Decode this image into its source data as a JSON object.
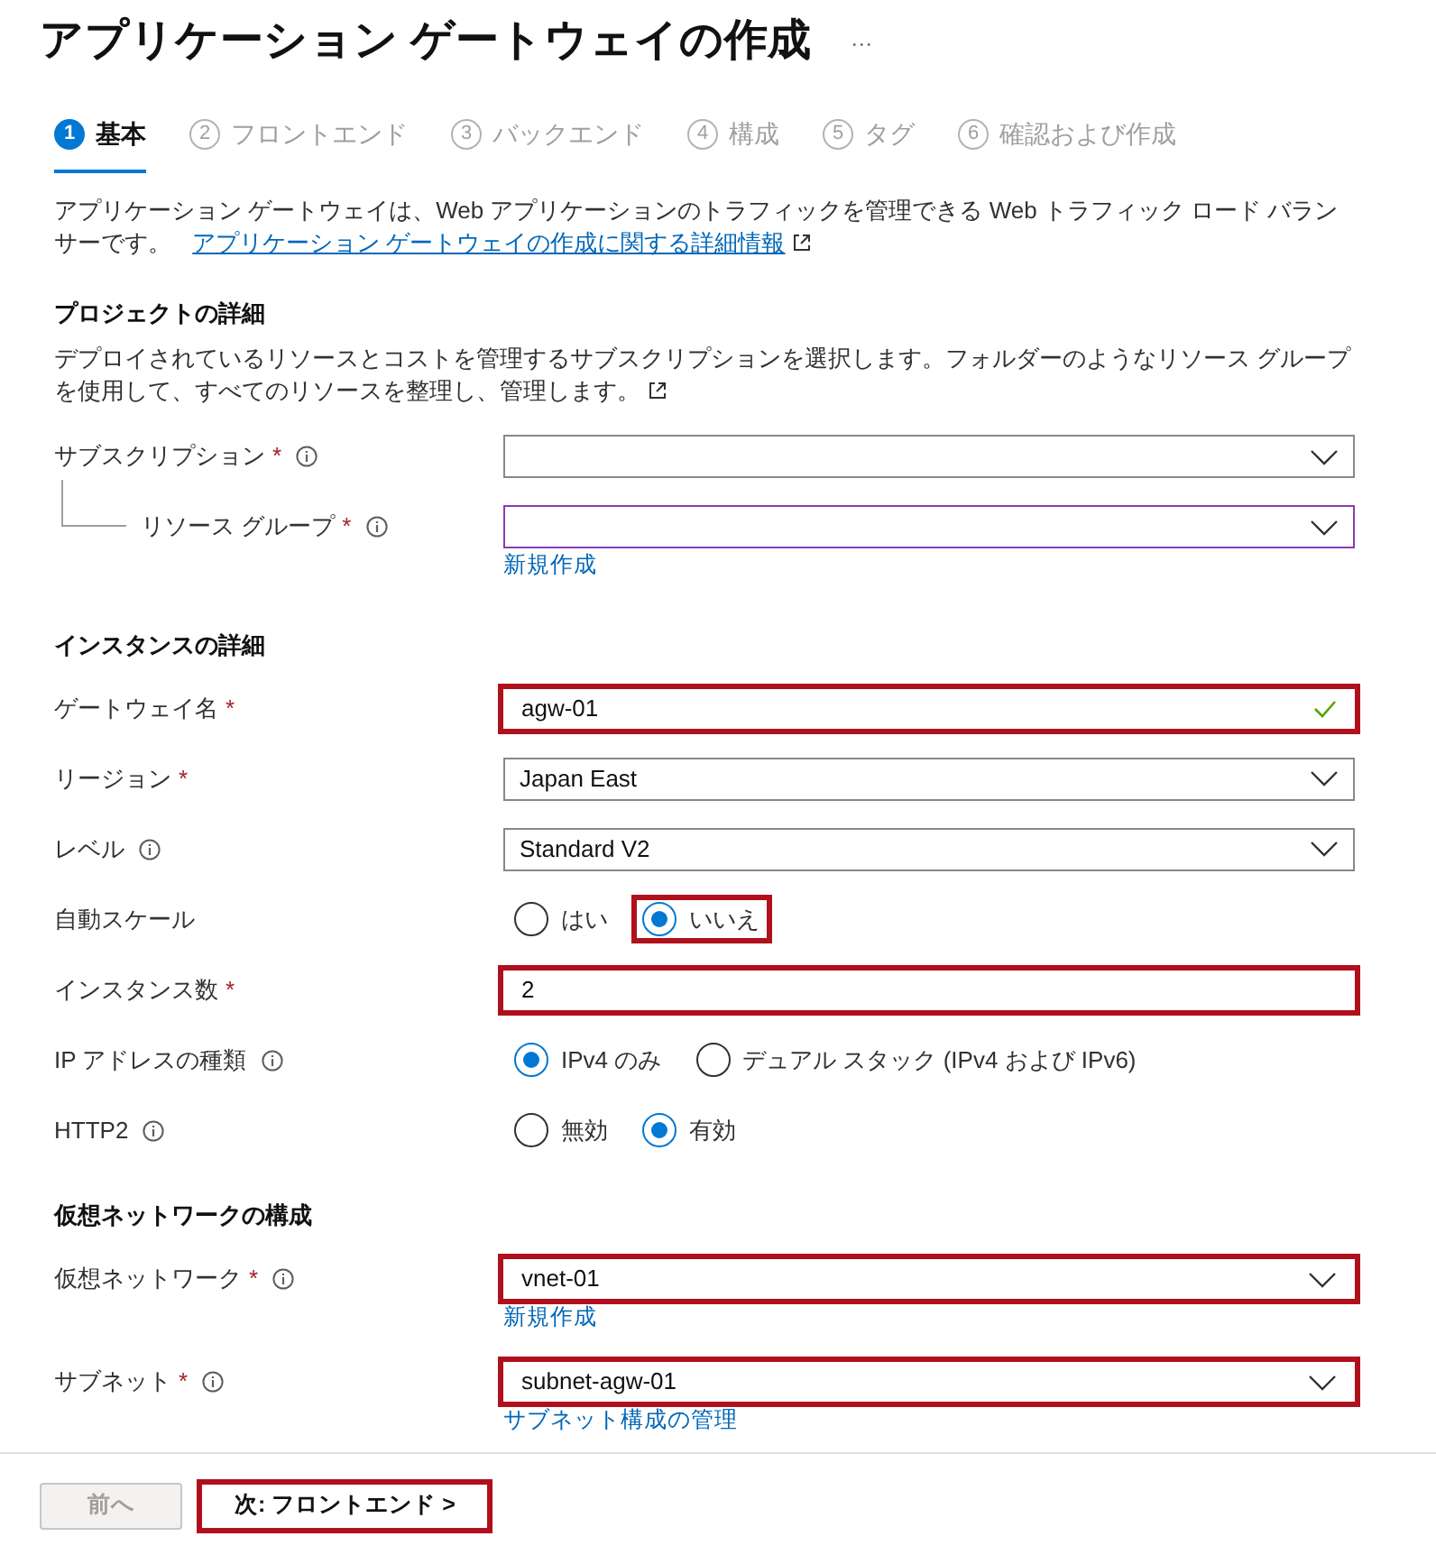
{
  "title": "アプリケーション ゲートウェイの作成",
  "more": "···",
  "steps": [
    {
      "number": "1",
      "label": "基本",
      "selected": true
    },
    {
      "number": "2",
      "label": "フロントエンド",
      "selected": false
    },
    {
      "number": "3",
      "label": "バックエンド",
      "selected": false
    },
    {
      "number": "4",
      "label": "構成",
      "selected": false
    },
    {
      "number": "5",
      "label": "タグ",
      "selected": false
    },
    {
      "number": "6",
      "label": "確認および作成",
      "selected": false
    }
  ],
  "intro": {
    "text": "アプリケーション ゲートウェイは、Web アプリケーションのトラフィックを管理できる Web トラフィック ロード バランサーです。",
    "link": "アプリケーション ゲートウェイの作成に関する詳細情報"
  },
  "sections": [
    {
      "heading": "プロジェクトの詳細",
      "description": "デプロイされているリソースとコストを管理するサブスクリプションを選択します。フォルダーのようなリソース グループを使用して、すべてのリソースを整理し、管理します。",
      "rows": [
        {
          "kind": "select",
          "label": "サブスクリプション",
          "required": "*",
          "info": true,
          "focused": false,
          "highlighted": false,
          "children": [
            {
              "kind": "select",
              "label": "リソース グループ",
              "required": "*",
              "info": true,
              "focused": true,
              "highlighted": false,
              "link": "新規作成"
            }
          ]
        }
      ]
    },
    {
      "heading": "インスタンスの詳細",
      "rows": [
        {
          "kind": "text",
          "label": "ゲートウェイ名",
          "required": "*",
          "value": "agw-01",
          "valid": true,
          "highlighted": true
        },
        {
          "kind": "select",
          "label": "リージョン",
          "required": "*",
          "value": "Japan East",
          "focused": false,
          "highlighted": false
        },
        {
          "kind": "select",
          "label": "レベル",
          "info": true,
          "value": "Standard V2",
          "focused": false,
          "highlighted": false
        },
        {
          "kind": "radio",
          "label": "自動スケール",
          "options": [
            {
              "label": "はい",
              "selected": false,
              "highlighted": false
            },
            {
              "label": "いいえ",
              "selected": true,
              "highlighted": true
            }
          ]
        },
        {
          "kind": "text",
          "label": "インスタンス数",
          "required": "*",
          "value": "2",
          "highlighted": true
        },
        {
          "kind": "radio",
          "label": "IP アドレスの種類",
          "info": true,
          "options": [
            {
              "label": "IPv4 のみ",
              "selected": true,
              "highlighted": false
            },
            {
              "label": "デュアル スタック (IPv4 および IPv6)",
              "selected": false,
              "highlighted": false
            }
          ]
        },
        {
          "kind": "radio",
          "label": "HTTP2",
          "info": true,
          "options": [
            {
              "label": "無効",
              "selected": false,
              "highlighted": false
            },
            {
              "label": "有効",
              "selected": true,
              "highlighted": false
            }
          ]
        }
      ]
    },
    {
      "heading": "仮想ネットワークの構成",
      "rows": [
        {
          "kind": "select",
          "label": "仮想ネットワーク",
          "required": "*",
          "info": true,
          "value": "vnet-01",
          "highlighted": true,
          "link": "新規作成"
        },
        {
          "kind": "select",
          "label": "サブネット",
          "required": "*",
          "info": true,
          "value": "subnet-agw-01",
          "highlighted": true,
          "link": "サブネット構成の管理"
        }
      ]
    }
  ],
  "footer": [
    {
      "label": "前へ",
      "disabled": true,
      "highlighted": false
    },
    {
      "label": "次: フロントエンド >",
      "disabled": false,
      "highlighted": true
    }
  ]
}
